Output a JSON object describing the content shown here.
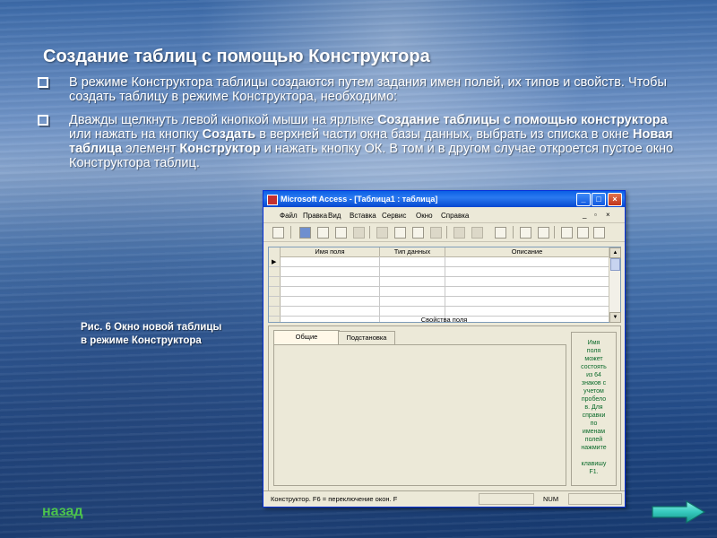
{
  "slide": {
    "title": "Создание таблиц с помощью Конструктора",
    "bullet1": "В режиме Конструктора таблицы создаются путем задания имен полей, их типов и свойств. Чтобы создать таблицу в режиме Конструктора, необходимо:",
    "bullet2": {
      "p1": "Дважды щелкнуть левой кнопкой мыши на ярлыке ",
      "b1": "Создание таблицы с помощью конструктора",
      "p2": " или нажать на кнопку ",
      "b2": "Создать",
      "p3": " в верхней части окна базы данных, выбрать из списка в окне ",
      "b3": "Новая таблица",
      "p4": " элемент ",
      "b4": "Конструктор",
      "p5": " и нажать кнопку ОК. В том и в другом случае откроется пустое окно Конструктора таблиц."
    },
    "caption_line1": "Рис. 6 Окно новой таблицы",
    "caption_line2": "в режиме Конструктора",
    "back_label": "назад",
    "accent_color": "#4cc44c"
  },
  "access_window": {
    "title": "Microsoft Access - [Таблица1 : таблица]",
    "menu": [
      "Файл",
      "Правка",
      "Вид",
      "Вставка",
      "Сервис",
      "Окно",
      "Справка"
    ],
    "columns": [
      "Имя поля",
      "Тип данных",
      "Описание"
    ],
    "properties_label": "Свойства поля",
    "tabs": [
      "Общие",
      "Подстановка"
    ],
    "help_lines": [
      "Имя",
      "поля",
      "может",
      "состоять",
      "из 64",
      "знаков с",
      "учетом",
      "пробело",
      "в. Для",
      "справки",
      "по",
      "именам",
      "полей",
      "нажмите",
      "",
      "клавишу",
      "F1."
    ],
    "status_text": "Конструктор.  F6 = переключение окон.  F",
    "status_num": "NUM"
  }
}
